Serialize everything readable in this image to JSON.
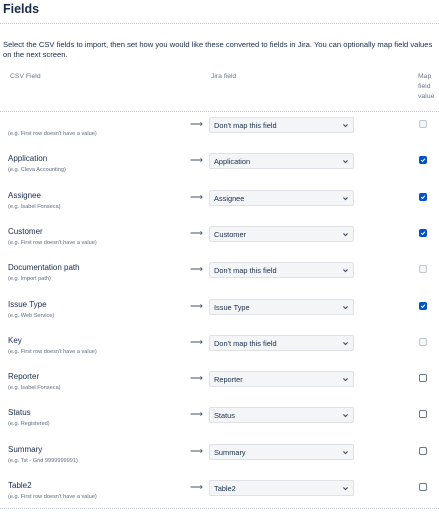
{
  "page": {
    "title": "Fields",
    "intro": "Select the CSV fields to import, then set how you would like these converted to fields in Jira. You can optionally map field values on the next screen."
  },
  "columns": {
    "csv_field": "CSV Field",
    "jira_field": "Jira field",
    "map_value": "Map field value"
  },
  "arrow_glyph": "⟶",
  "colors": {
    "checkbox_checked": "#0052cc",
    "select_bg": "#f4f5f7"
  },
  "rows": [
    {
      "name": "",
      "example": "(e.g. First row doesn't have a value)",
      "jira": "Don't map this field",
      "map": "disabled"
    },
    {
      "name": "Application",
      "example": "(e.g. Cleva Accounting)",
      "jira": "Application",
      "map": "checked"
    },
    {
      "name": "Assignee",
      "example": "(e.g. Isabel Fonseca)",
      "jira": "Assignee",
      "map": "checked"
    },
    {
      "name": "Customer",
      "example": "(e.g. First row doesn't have a value)",
      "jira": "Customer",
      "map": "checked"
    },
    {
      "name": "Documentation path",
      "example": "(e.g. Import path)",
      "jira": "Don't map this field",
      "map": "disabled"
    },
    {
      "name": "Issue Type",
      "example": "(e.g. Web Service)",
      "jira": "Issue Type",
      "map": "checked"
    },
    {
      "name": "Key",
      "example": "(e.g. First row doesn't have a value)",
      "jira": "Don't map this field",
      "map": "disabled"
    },
    {
      "name": "Reporter",
      "example": "(e.g. Isabel Fonseca)",
      "jira": "Reporter",
      "map": "unchecked"
    },
    {
      "name": "Status",
      "example": "(e.g. Registered)",
      "jira": "Status",
      "map": "unchecked"
    },
    {
      "name": "Summary",
      "example": "(e.g. Tst - Grid 9999999991)",
      "jira": "Summary",
      "map": "unchecked"
    },
    {
      "name": "Table2",
      "example": "(e.g. First row doesn't have a value)",
      "jira": "Table2",
      "map": "unchecked"
    }
  ]
}
